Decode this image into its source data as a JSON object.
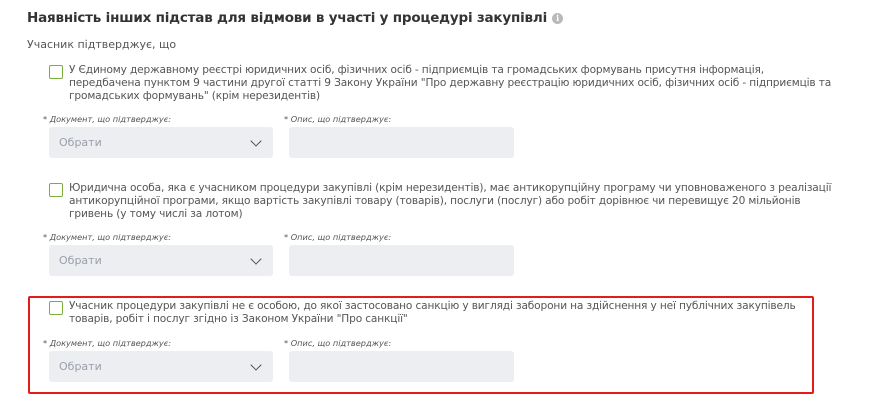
{
  "section": {
    "title": "Наявність інших підстав для відмови в участі у процедурі закупівлі",
    "info_icon": "info-icon",
    "subtitle": "Учасник підтверджує, що"
  },
  "items": [
    {
      "text_lines": [
        "У Єдиному державному реєстрі юридичних осіб, фізичних осіб - підприємців та громадських формувань присутня інформація,",
        "передбачена пунктом 9 частини другої статті 9 Закону України \"Про державну реєстрацію юридичних осіб, фізичних осіб - підприємців та",
        "громадських формувань\" (крім нерезидентів)"
      ],
      "doc_label": "* Документ, що підтверджує:",
      "desc_label": "* Опис, що підтверджує:",
      "select_value": "Обрати",
      "desc_value": ""
    },
    {
      "text_lines": [
        "Юридична особа, яка є учасником процедури закупівлі (крім нерезидентів), має антикорупційну програму чи уповноваженого з реалізації",
        "антикорупційної програми, якщо вартість закупівлі товару (товарів), послуги (послуг) або робіт дорівнює чи перевищує 20 мільйонів",
        "гривень (у тому числі за лотом)"
      ],
      "doc_label": "* Документ, що підтверджує:",
      "desc_label": "* Опис, що підтверджує:",
      "select_value": "Обрати",
      "desc_value": ""
    },
    {
      "text_lines": [
        "Учасник процедури закупівлі не є особою, до якої застосовано санкцію у вигляді заборони на здійснення у неї публічних закупівель",
        "товарів, робіт і послуг згідно із Законом України \"Про санкції\""
      ],
      "doc_label": "* Документ, що підтверджує:",
      "desc_label": "* Опис, що підтверджує:",
      "select_value": "Обрати",
      "desc_value": "",
      "highlighted": true
    }
  ],
  "colors": {
    "checkbox_border": "#7cae3e",
    "highlight_border": "#e41b17",
    "field_bg": "#eceef2"
  }
}
